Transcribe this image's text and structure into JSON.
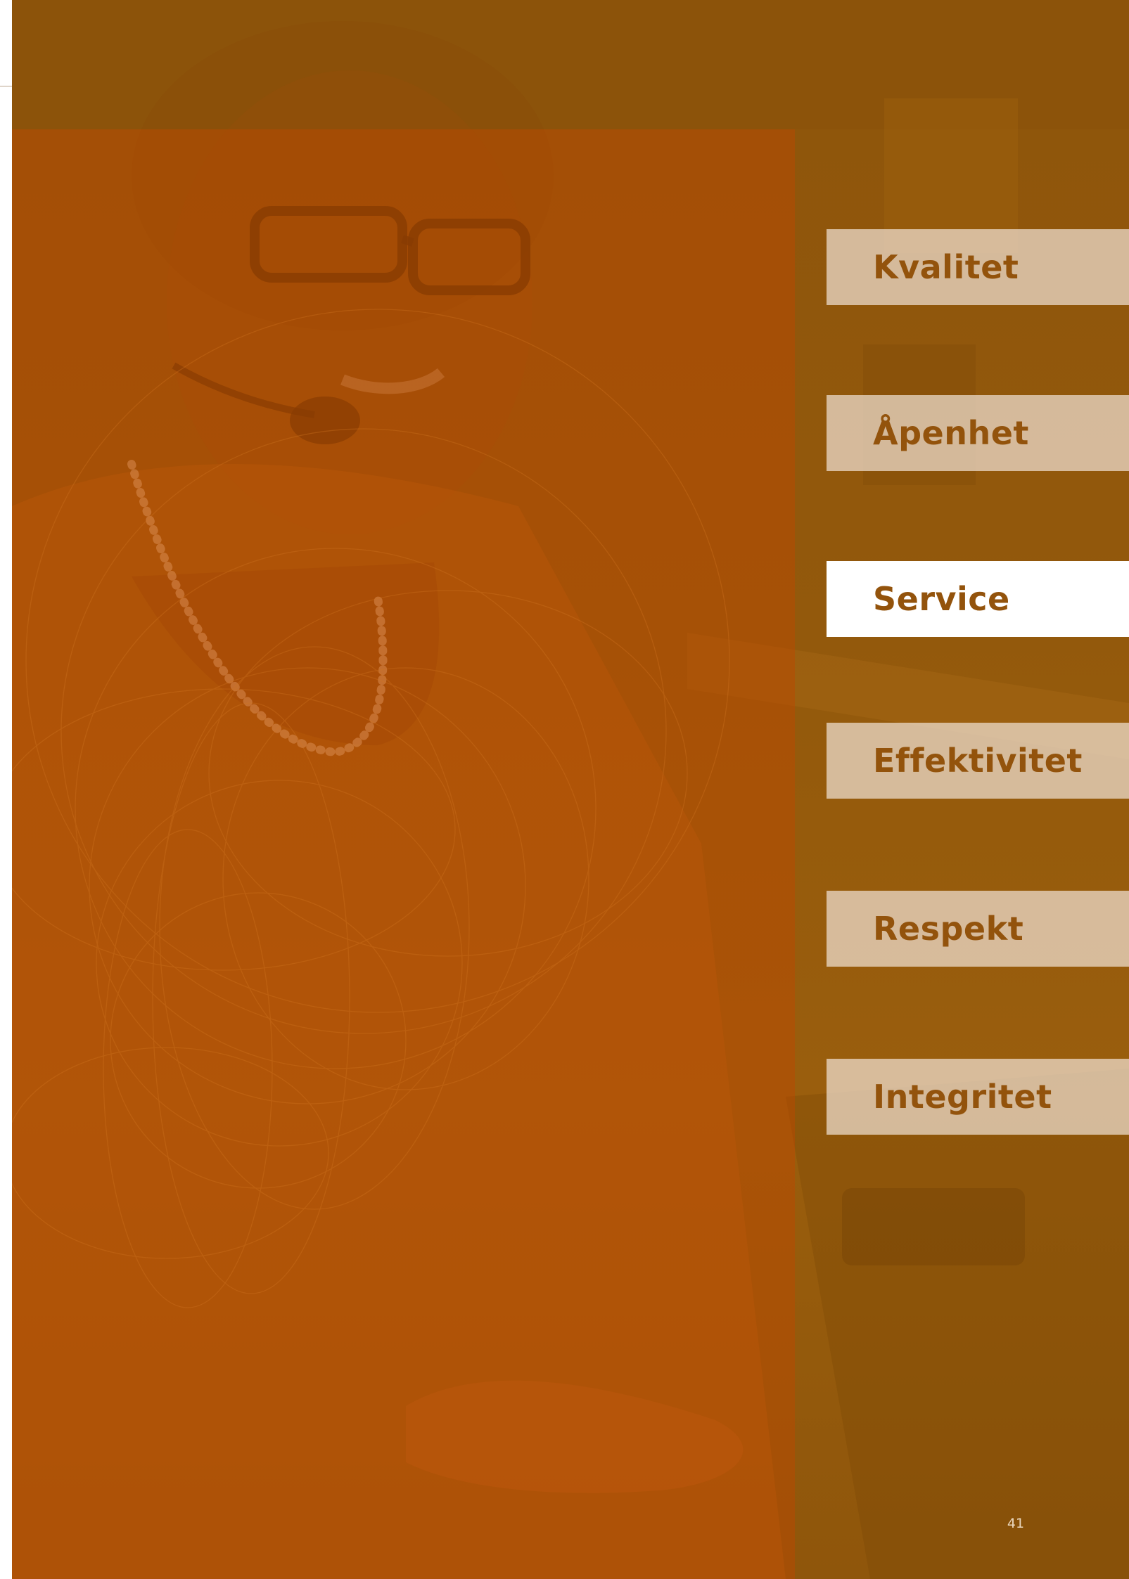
{
  "values": {
    "items": [
      {
        "label": "Kvalitet",
        "active": false
      },
      {
        "label": "Åpenhet",
        "active": false
      },
      {
        "label": "Service",
        "active": true
      },
      {
        "label": "Effektivitet",
        "active": false
      },
      {
        "label": "Respekt",
        "active": false
      },
      {
        "label": "Integritet",
        "active": false
      }
    ]
  },
  "page_number": "41",
  "colors": {
    "page_tint": "#93590c",
    "overlay_panel": "#be4800",
    "tag_text": "#93530c",
    "tag_background": "#f0e1d2",
    "tag_active_background": "#ffffff"
  }
}
